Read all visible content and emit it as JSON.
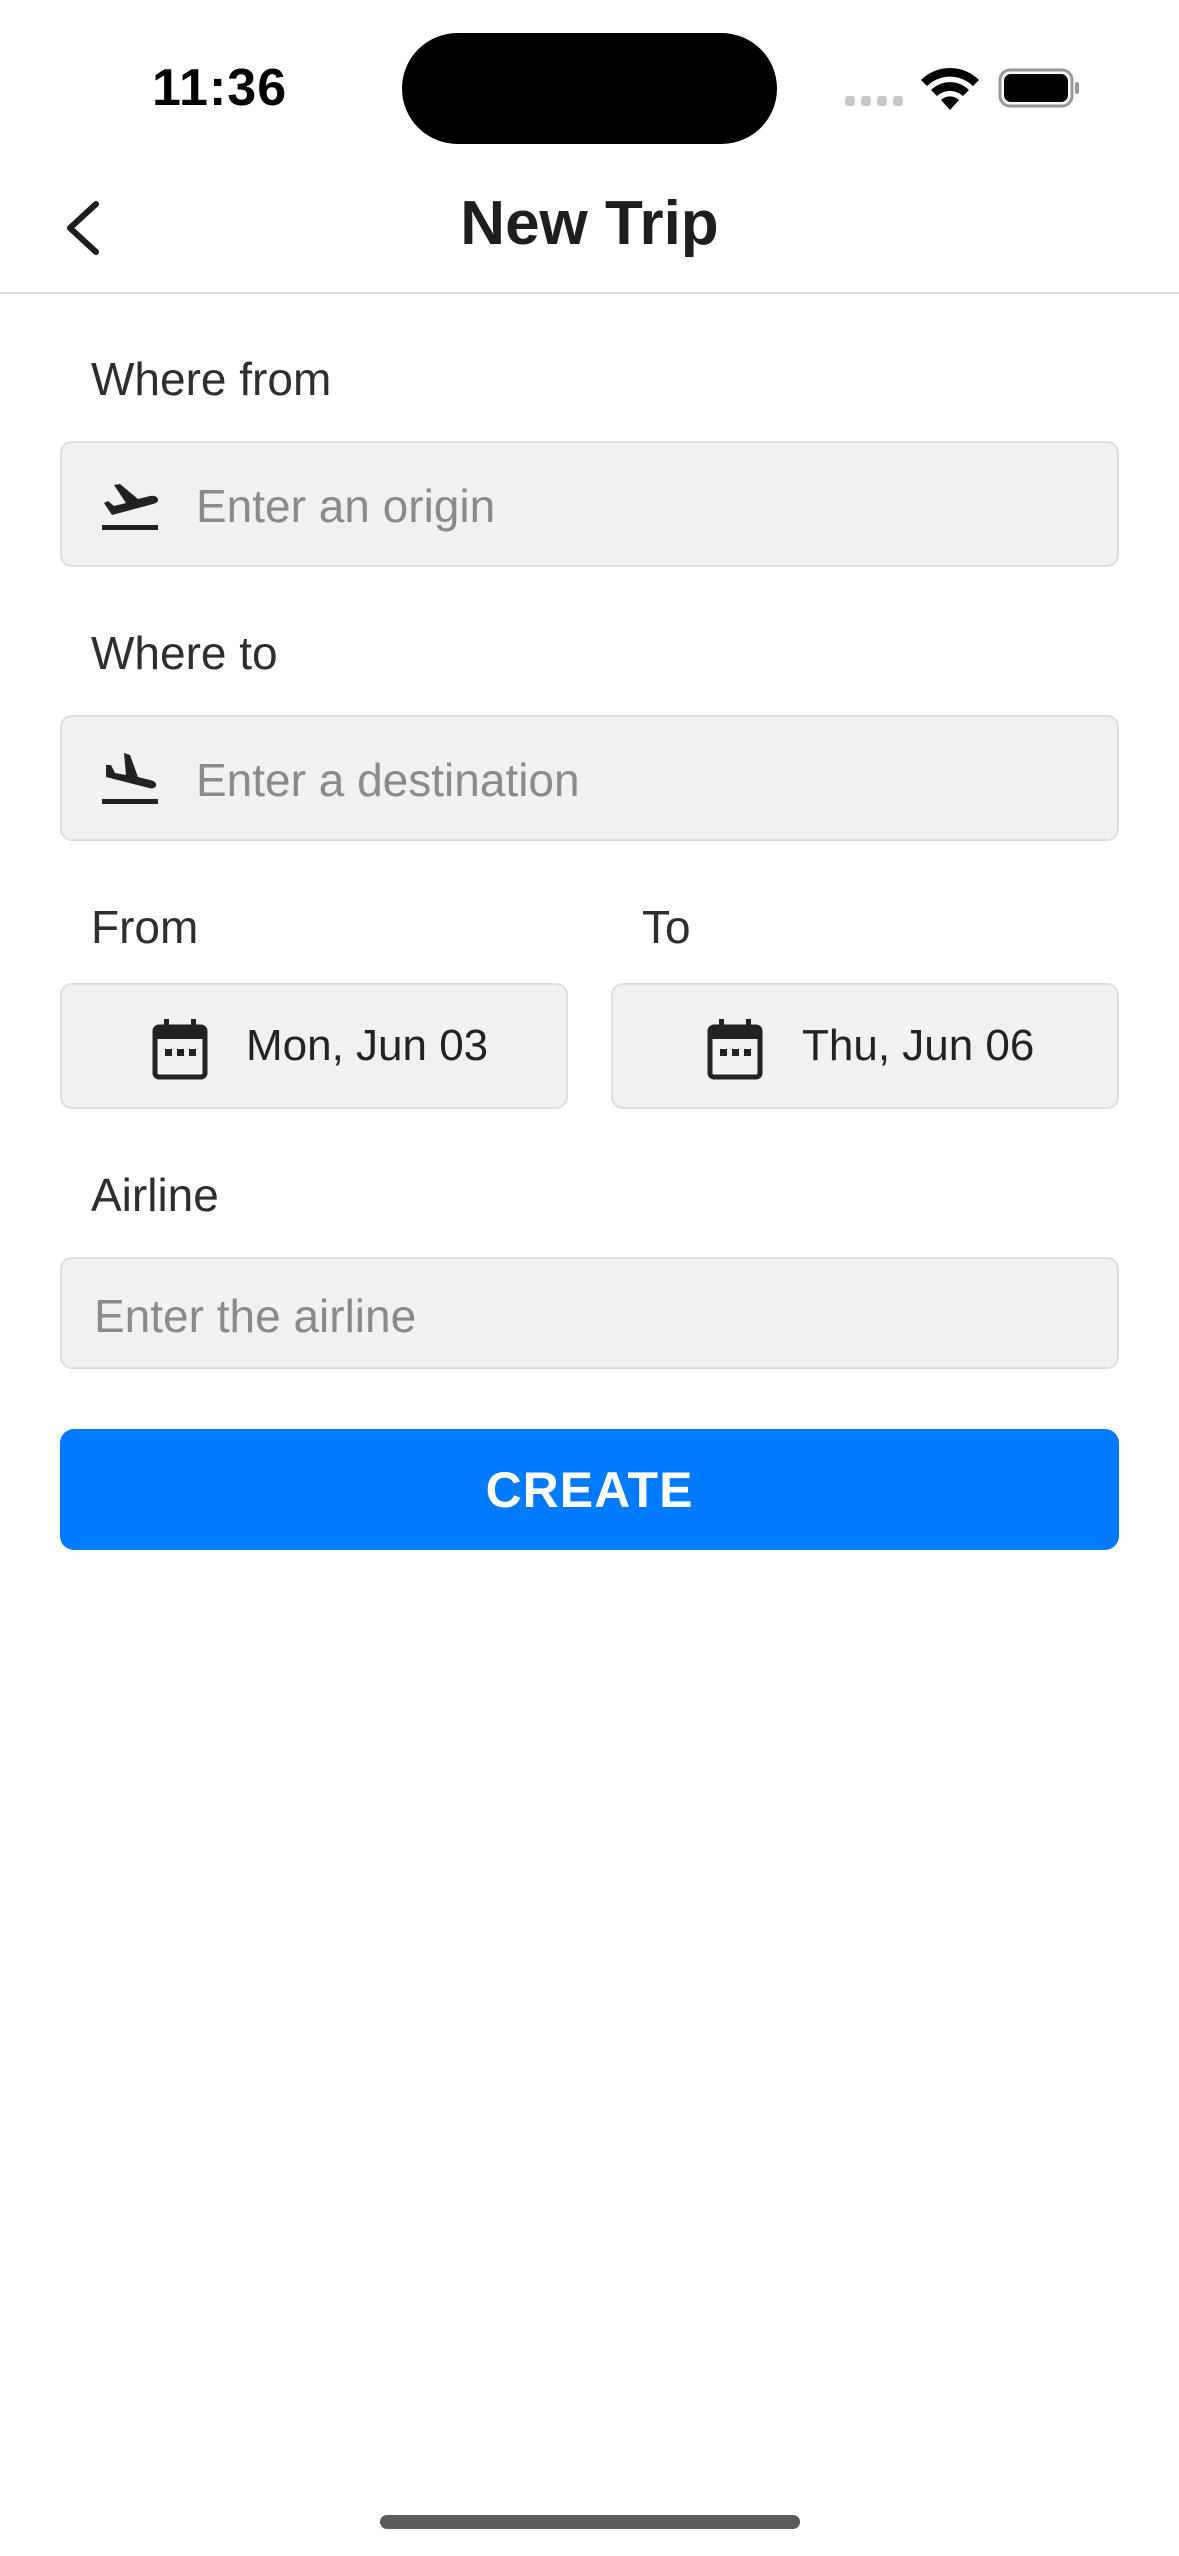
{
  "status_bar": {
    "time": "11:36"
  },
  "header": {
    "title": "New Trip",
    "back_icon": "chevron-left-icon"
  },
  "form": {
    "origin": {
      "label": "Where from",
      "placeholder": "Enter an origin",
      "icon": "airplane-takeoff-icon"
    },
    "destination": {
      "label": "Where to",
      "placeholder": "Enter a destination",
      "icon": "airplane-landing-icon"
    },
    "dates": {
      "from_label": "From",
      "from_value": "Mon, Jun 03",
      "to_label": "To",
      "to_value": "Thu, Jun 06",
      "icon": "calendar-icon"
    },
    "airline": {
      "label": "Airline",
      "placeholder": "Enter the airline"
    },
    "create_label": "CREATE"
  },
  "colors": {
    "accent": "#007aff",
    "field_bg": "#f1f1f1",
    "placeholder": "#8a8a8a"
  }
}
